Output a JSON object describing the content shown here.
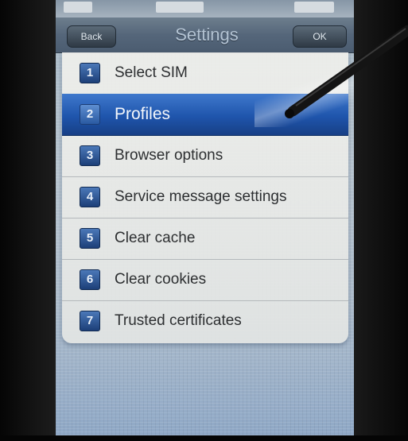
{
  "header": {
    "back_label": "Back",
    "title": "Settings",
    "ok_label": "OK"
  },
  "menu": {
    "items": [
      {
        "number": "1",
        "label": "Select SIM",
        "selected": false
      },
      {
        "number": "2",
        "label": "Profiles",
        "selected": true
      },
      {
        "number": "3",
        "label": "Browser options",
        "selected": false
      },
      {
        "number": "4",
        "label": "Service message settings",
        "selected": false
      },
      {
        "number": "5",
        "label": "Clear cache",
        "selected": false
      },
      {
        "number": "6",
        "label": "Clear cookies",
        "selected": false
      },
      {
        "number": "7",
        "label": "Trusted certificates",
        "selected": false
      }
    ]
  },
  "colors": {
    "selection": "#1f55ac",
    "header": "#55667a",
    "list_background": "#ecece8"
  }
}
